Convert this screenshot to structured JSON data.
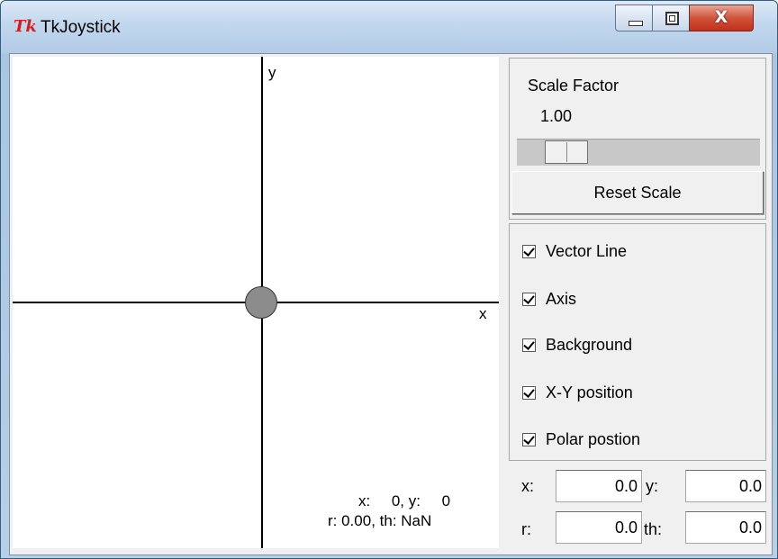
{
  "window": {
    "title": "TkJoystick",
    "app_icon": "Tk",
    "close_glyph": "X"
  },
  "canvas": {
    "y_axis_label": "y",
    "x_axis_label": "x",
    "xy_readout": "x:     0, y:     0",
    "polar_readout": "r: 0.00, th: NaN"
  },
  "scale": {
    "label": "Scale Factor",
    "value": "1.00",
    "slider_fraction": 0.14,
    "reset_label": "Reset Scale"
  },
  "options": [
    {
      "label": "Vector Line",
      "checked": true
    },
    {
      "label": "Axis",
      "checked": true
    },
    {
      "label": "Background",
      "checked": true
    },
    {
      "label": "X-Y position",
      "checked": true
    },
    {
      "label": "Polar postion",
      "checked": true
    }
  ],
  "fields": {
    "x_label": "x:",
    "x_value": "0.0",
    "y_label": "y:",
    "y_value": "0.0",
    "r_label": "r:",
    "r_value": "0.0",
    "th_label": "th:",
    "th_value": "0.0"
  },
  "colors": {
    "stick_fill": "#8c8c8c",
    "close_button": "#c12f1a",
    "app_icon": "#cc1f1f"
  }
}
